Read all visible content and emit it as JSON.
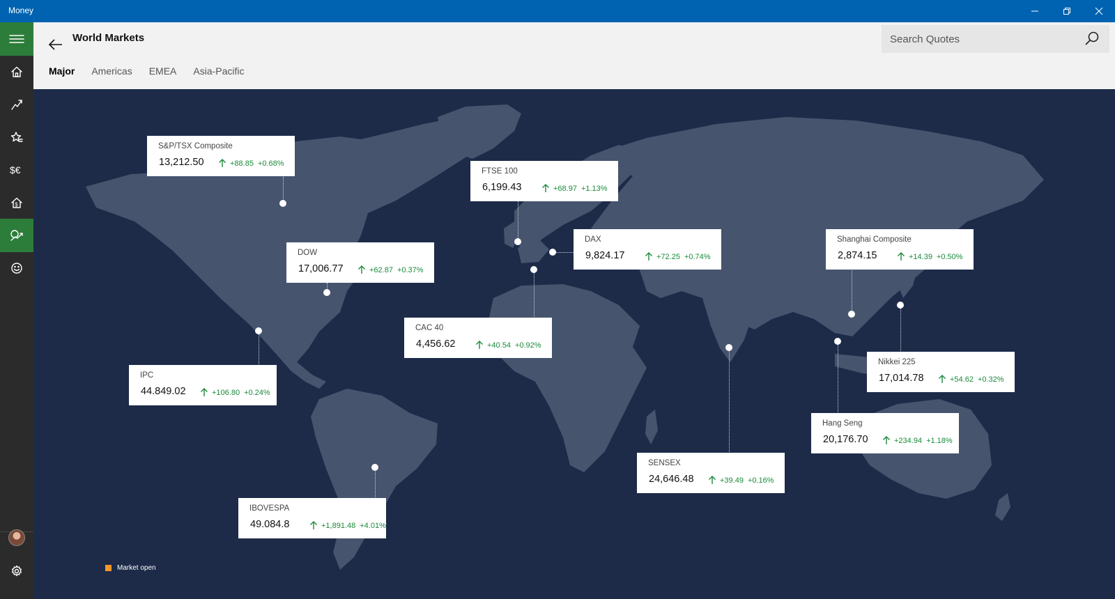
{
  "window": {
    "title": "Money"
  },
  "header": {
    "title": "World Markets",
    "search_placeholder": "Search Quotes",
    "tabs": [
      {
        "label": "Major",
        "active": true
      },
      {
        "label": "Americas",
        "active": false
      },
      {
        "label": "EMEA",
        "active": false
      },
      {
        "label": "Asia-Pacific",
        "active": false
      }
    ]
  },
  "rail": {
    "items": [
      "menu-icon",
      "home-icon",
      "trend-icon",
      "watchlist-icon",
      "currency-icon",
      "mortgage-icon",
      "world-markets-icon",
      "feedback-icon"
    ],
    "selected": "world-markets-icon",
    "accent": "#2d7d3a"
  },
  "markets": [
    {
      "name": "S&P/TSX Composite",
      "price": "13,212.50",
      "change": "+88.85",
      "pct": "+0.68%"
    },
    {
      "name": "FTSE 100",
      "price": "6,199.43",
      "change": "+68.97",
      "pct": "+1.13%"
    },
    {
      "name": "DOW",
      "price": "17,006.77",
      "change": "+62.87",
      "pct": "+0.37%"
    },
    {
      "name": "DAX",
      "price": "9,824.17",
      "change": "+72.25",
      "pct": "+0.74%"
    },
    {
      "name": "Shanghai Composite",
      "price": "2,874.15",
      "change": "+14.39",
      "pct": "+0.50%"
    },
    {
      "name": "CAC 40",
      "price": "4,456.62",
      "change": "+40.54",
      "pct": "+0.92%"
    },
    {
      "name": "IPC",
      "price": "44.849.02",
      "change": "+106.80",
      "pct": "+0.24%"
    },
    {
      "name": "Nikkei 225",
      "price": "17,014.78",
      "change": "+54.62",
      "pct": "+0.32%"
    },
    {
      "name": "Hang Seng",
      "price": "20,176.70",
      "change": "+234.94",
      "pct": "+1.18%"
    },
    {
      "name": "SENSEX",
      "price": "24,646.48",
      "change": "+39.49",
      "pct": "+0.16%"
    },
    {
      "name": "IBOVESPA",
      "price": "49.084.8",
      "change": "+1,891.48",
      "pct": "+4.01%"
    }
  ],
  "legend": {
    "label": "Market open",
    "color": "#f4962b"
  },
  "colors": {
    "titlebar": "#0063b1",
    "map_bg": "#1d2b49",
    "land": "#47546e",
    "up": "#1a8a3a"
  }
}
